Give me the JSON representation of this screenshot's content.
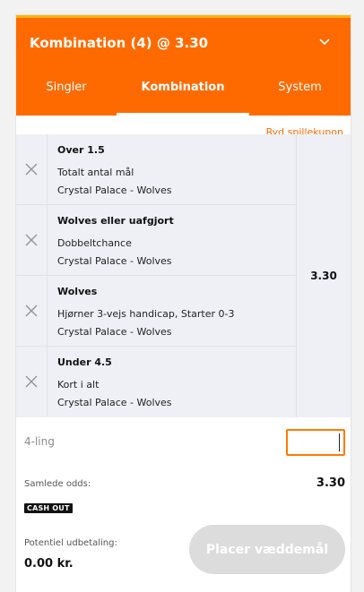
{
  "header": {
    "title": "Kombination (4) @ 3.30",
    "accent_color": "#ff6a00",
    "top_line_color": "#ffb300",
    "toggle_icon": "chevron-down-icon"
  },
  "tabs": [
    {
      "label": "Singler",
      "active": false
    },
    {
      "label": "Kombination",
      "active": true
    },
    {
      "label": "System",
      "active": false
    }
  ],
  "clear_label": "Ryd spillekupon",
  "selections": [
    {
      "title": "Over 1.5",
      "market": "Totalt antal mål",
      "match": "Crystal Palace - Wolves"
    },
    {
      "title": "Wolves eller uafgjort",
      "market": "Dobbeltchance",
      "match": "Crystal Palace - Wolves"
    },
    {
      "title": "Wolves",
      "market": "Hjørner 3-vejs handicap, Starter 0-3",
      "match": "Crystal Palace - Wolves"
    },
    {
      "title": "Under 4.5",
      "market": "Kort i alt",
      "match": "Crystal Palace - Wolves"
    }
  ],
  "combined_odds": "3.30",
  "stake": {
    "label": "4-ling",
    "value": ""
  },
  "summary": {
    "total_odds_label": "Samlede odds:",
    "total_odds_value": "3.30",
    "cashout_badge": "CASH OUT",
    "payout_label": "Potentiel udbetaling:",
    "payout_value": "0.00 kr."
  },
  "place_button_label": "Placer væddemål"
}
